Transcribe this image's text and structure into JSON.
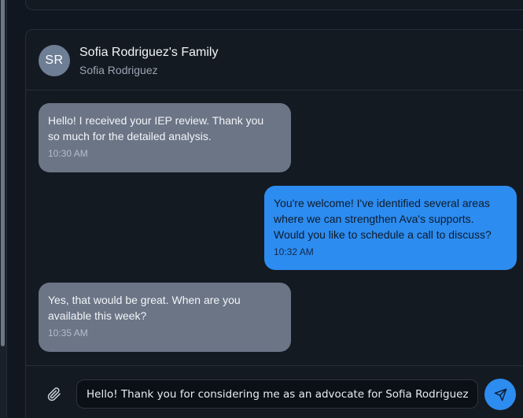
{
  "conversation": {
    "avatar_initials": "SR",
    "title": "Sofia Rodriguez's Family",
    "subtitle": "Sofia Rodriguez"
  },
  "messages": [
    {
      "direction": "incoming",
      "text": "Hello! I received your IEP review. Thank you\nso much for the detailed analysis.",
      "time": "10:30 AM"
    },
    {
      "direction": "outgoing",
      "text": "You're welcome! I've identified several areas\nwhere we can strengthen Ava's supports.\nWould you like to schedule a call to discuss?",
      "time": "10:32 AM"
    },
    {
      "direction": "incoming",
      "text": "Yes, that would be great. When are you\navailable this week?",
      "time": "10:35 AM"
    }
  ],
  "composer": {
    "value": "Hello! Thank you for considering me as an advocate for Sofia Rodriguez. I'",
    "attach_icon": "paperclip-icon",
    "send_icon": "send-icon"
  },
  "colors": {
    "background": "#111720",
    "card": "#141a22",
    "incoming_bubble": "#6b7586",
    "outgoing_bubble": "#2d8cf0",
    "avatar": "#6e7e94",
    "send_button": "#2d8cf0"
  }
}
